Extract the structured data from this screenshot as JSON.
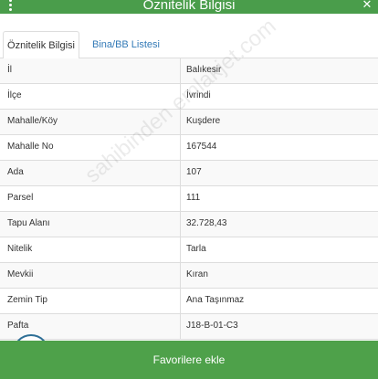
{
  "header": {
    "title": "Öznitelik Bilgisi",
    "left_icon": "vertical-dots-icon",
    "right_icon": "close-icon",
    "color": "#4a9d4b"
  },
  "tabs": [
    {
      "label": "Öznitelik Bilgisi",
      "active": true
    },
    {
      "label": "Bina/BB Listesi",
      "active": false
    }
  ],
  "table": {
    "rows": [
      {
        "key": "İl",
        "value": "Balıkesir"
      },
      {
        "key": "İlçe",
        "value": "İvrindi"
      },
      {
        "key": "Mahalle/Köy",
        "value": "Kuşdere"
      },
      {
        "key": "Mahalle No",
        "value": "167544"
      },
      {
        "key": "Ada",
        "value": "107"
      },
      {
        "key": "Parsel",
        "value": "111"
      },
      {
        "key": "Tapu Alanı",
        "value": "32.728,43"
      },
      {
        "key": "Nitelik",
        "value": "Tarla"
      },
      {
        "key": "Mevkii",
        "value": "Kıran"
      },
      {
        "key": "Zemin Tip",
        "value": "Ana Taşınmaz"
      },
      {
        "key": "Pafta",
        "value": "J18-B-01-C3"
      }
    ]
  },
  "watermark": "sahibinden emlakjet.com",
  "favorite_button": {
    "label": "Favorilere ekle",
    "color": "#4ea14a"
  }
}
